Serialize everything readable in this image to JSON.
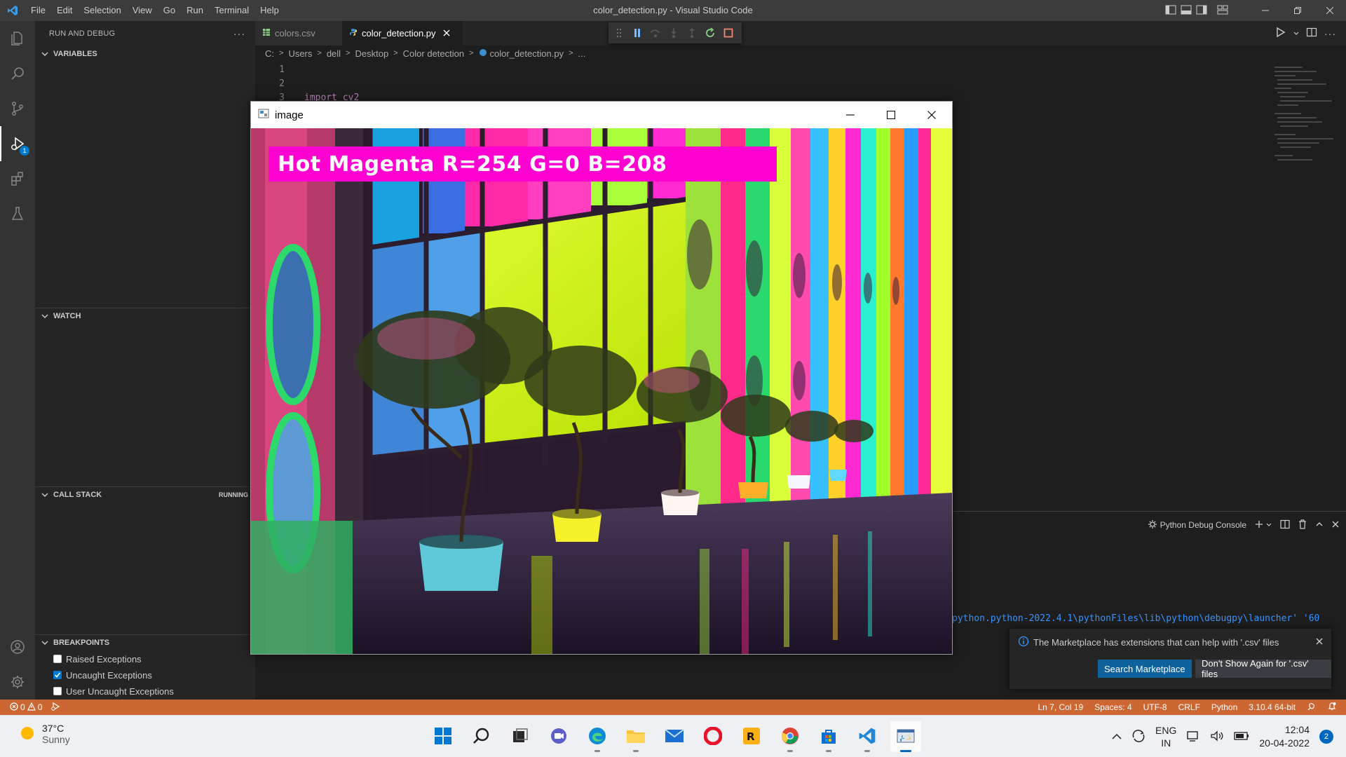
{
  "titlebar": {
    "menu": [
      "File",
      "Edit",
      "Selection",
      "View",
      "Go",
      "Run",
      "Terminal",
      "Help"
    ],
    "window_title": "color_detection.py - Visual Studio Code"
  },
  "sidebar": {
    "title": "RUN AND DEBUG",
    "sections": {
      "variables": "VARIABLES",
      "watch": "WATCH",
      "call_stack": "CALL STACK",
      "call_stack_status": "RUNNING",
      "breakpoints": "BREAKPOINTS"
    },
    "breakpoints": [
      {
        "label": "Raised Exceptions",
        "checked": false
      },
      {
        "label": "Uncaught Exceptions",
        "checked": true
      },
      {
        "label": "User Uncaught Exceptions",
        "checked": false
      }
    ]
  },
  "activity": {
    "debug_badge": "1"
  },
  "tabs": [
    {
      "label": "colors.csv",
      "active": false
    },
    {
      "label": "color_detection.py",
      "active": true
    }
  ],
  "breadcrumb": [
    "C:",
    "Users",
    "dell",
    "Desktop",
    "Color detection",
    "color_detection.py",
    "..."
  ],
  "editor": {
    "line_numbers": [
      "1",
      "2",
      "3"
    ],
    "visible_code": "import cv2"
  },
  "panel": {
    "console_label": "Python Debug Console",
    "console_line": "python.python-2022.4.1\\pythonFiles\\lib\\python\\debugpy\\launcher' '60"
  },
  "notification": {
    "message": "The Marketplace has extensions that can help with '.csv' files",
    "primary_button": "Search Marketplace",
    "secondary_button": "Don't Show Again for '.csv' files"
  },
  "statusbar": {
    "errors": "0",
    "warnings": "0",
    "position": "Ln 7, Col 19",
    "spaces": "Spaces: 4",
    "encoding": "UTF-8",
    "eol": "CRLF",
    "language": "Python",
    "interpreter": "3.10.4 64-bit"
  },
  "image_window": {
    "title": "image",
    "detected_label": "Hot Magenta R=254 G=0 B=208",
    "label_color": "#fe00d0"
  },
  "taskbar": {
    "temperature": "37°C",
    "condition": "Sunny",
    "lang_line1": "ENG",
    "lang_line2": "IN",
    "time": "12:04",
    "date": "20-04-2022",
    "notification_count": "2"
  },
  "colors": {
    "accent": "#007acc",
    "statusbar": "#cc6633",
    "console_text": "#3794ff"
  }
}
